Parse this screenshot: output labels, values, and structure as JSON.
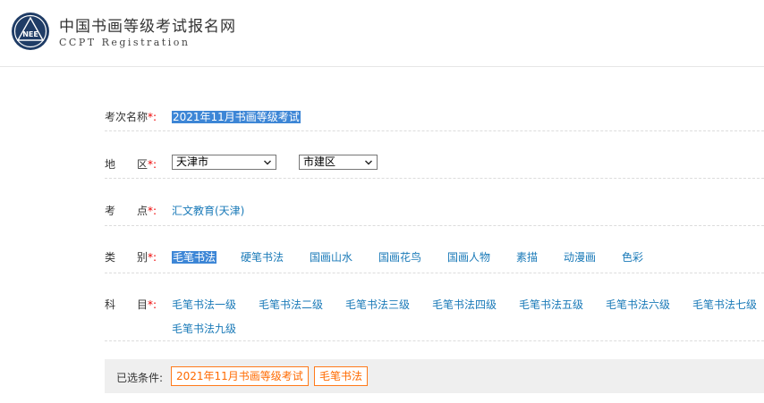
{
  "header": {
    "logo_text": "NEE",
    "title": "中国书画等级考试报名网",
    "subtitle": "CCPT Registration"
  },
  "exam": {
    "label": "考次名称",
    "star": "*:",
    "value": "2021年11月书画等级考试"
  },
  "region": {
    "label": "地　　区",
    "star": "*:",
    "city": "天津市",
    "district": "市建区"
  },
  "venue": {
    "label": "考　　点",
    "star": "*:",
    "value": "汇文教育(天津)"
  },
  "category": {
    "label": "类　　别",
    "star": "*:",
    "items": [
      "毛笔书法",
      "硬笔书法",
      "国画山水",
      "国画花鸟",
      "国画人物",
      "素描",
      "动漫画",
      "色彩"
    ]
  },
  "subject": {
    "label": "科　　目",
    "star": "*:",
    "items": [
      "毛笔书法一级",
      "毛笔书法二级",
      "毛笔书法三级",
      "毛笔书法四级",
      "毛笔书法五级",
      "毛笔书法六级",
      "毛笔书法七级",
      "毛笔书法九级"
    ]
  },
  "chosen": {
    "label": "已选条件:",
    "tags": [
      "2021年11月书画等级考试",
      "毛笔书法"
    ]
  },
  "colors": {
    "link": "#1a7ab8",
    "highlight": "#3d86d6",
    "required": "#ee0000",
    "tag": "#ff6a00"
  }
}
